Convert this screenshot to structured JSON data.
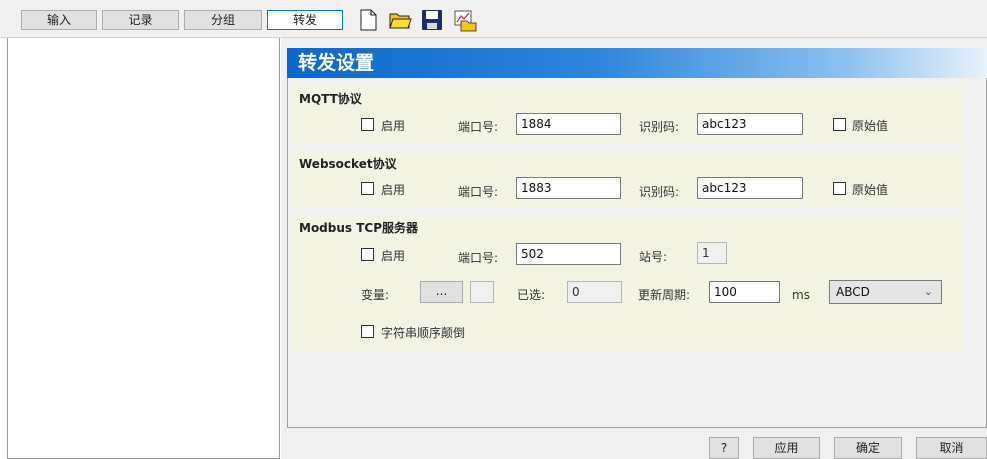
{
  "toolbar": {
    "tabs": [
      {
        "label": "输入"
      },
      {
        "label": "记录"
      },
      {
        "label": "分组"
      },
      {
        "label": "转发"
      }
    ],
    "icons": [
      "new-file-icon",
      "open-folder-icon",
      "save-icon",
      "export-chart-icon"
    ]
  },
  "panel": {
    "title": "转发设置",
    "mqtt": {
      "title": "MQTT协议",
      "enable_label": "启用",
      "port_label": "端口号:",
      "port_value": "1884",
      "code_label": "识别码:",
      "code_value": "abc123",
      "raw_label": "原始值"
    },
    "websocket": {
      "title": "Websocket协议",
      "enable_label": "启用",
      "port_label": "端口号:",
      "port_value": "1883",
      "code_label": "识别码:",
      "code_value": "abc123",
      "raw_label": "原始值"
    },
    "modbus": {
      "title": "Modbus TCP服务器",
      "enable_label": "启用",
      "port_label": "端口号:",
      "port_value": "502",
      "station_label": "站号:",
      "station_value": "1",
      "var_label": "变量:",
      "var_button": "...",
      "selected_label": "已选:",
      "selected_value": "0",
      "period_label": "更新周期:",
      "period_value": "100",
      "period_unit": "ms",
      "byte_order": "ABCD",
      "reverse_label": "字符串顺序颠倒"
    }
  },
  "footer": {
    "help": "?",
    "apply": "应用",
    "ok": "确定",
    "cancel": "取消"
  }
}
